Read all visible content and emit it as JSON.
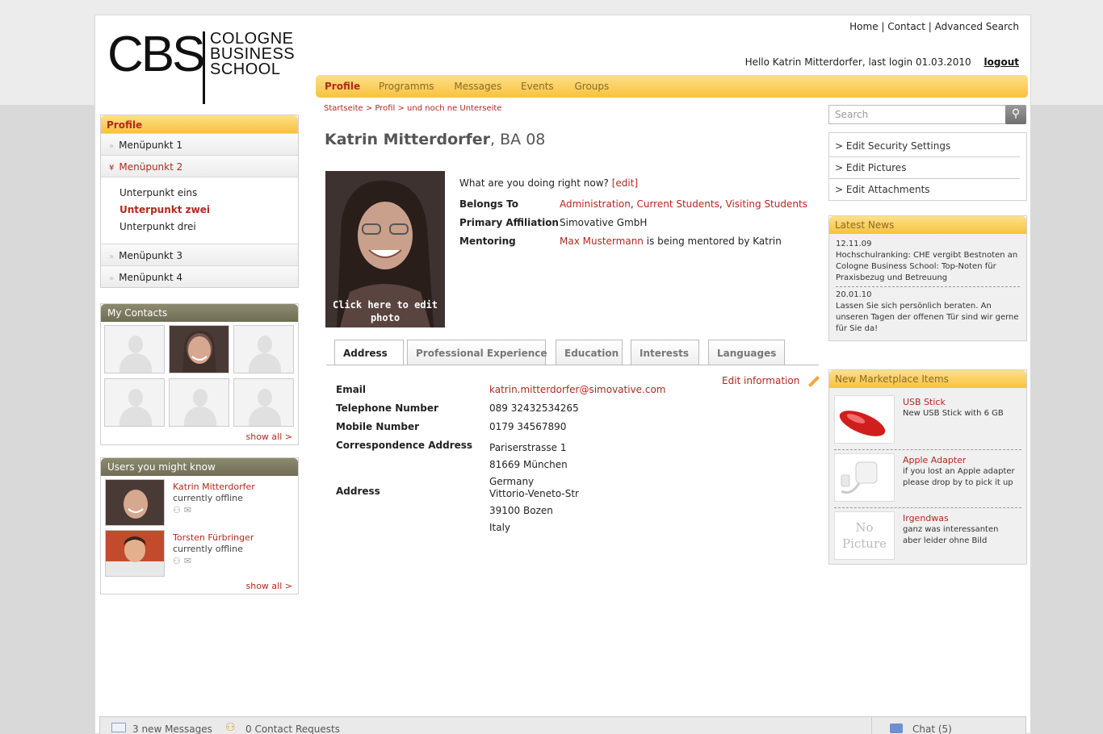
{
  "logo": {
    "abbr": "CBS",
    "line1": "COLOGNE",
    "line2": "BUSINESS",
    "line3": "SCHOOL"
  },
  "toplinks": {
    "home": "Home",
    "contact": "Contact",
    "advanced": "Advanced Search",
    "sep": "|"
  },
  "user": {
    "greeting": "Hello Katrin Mitterdorfer, last login 01.03.2010",
    "logout": "logout"
  },
  "nav": [
    "Profile",
    "Programms",
    "Messages",
    "Events",
    "Groups"
  ],
  "breadcrumb": "Startseite > Profil > und noch ne Unterseite",
  "sidebar": {
    "title": "Profile",
    "items": [
      "Menüpunkt 1",
      "Menüpunkt 2",
      "Menüpunkt 3",
      "Menüpunkt 4"
    ],
    "subitems": [
      "Unterpunkt eins",
      "Unterpunkt zwei",
      "Unterpunkt drei"
    ]
  },
  "contacts": {
    "title": "My Contacts",
    "show_all": "show all >"
  },
  "suggest": {
    "title": "Users you might know",
    "users": [
      {
        "name": "Katrin Mitterdorfer",
        "status": "currently offline"
      },
      {
        "name": "Torsten Fürbringer",
        "status": "currently offline"
      }
    ],
    "show_all": "show all >"
  },
  "profile": {
    "name": "Katrin Mitterdorfer",
    "suffix": ", BA 08",
    "photo_caption_1": "Click here to edit",
    "photo_caption_2": "photo",
    "status_q": "What are you doing right now?",
    "edit": "[edit]",
    "belongs_label": "Belongs To",
    "belongs": [
      "Administration",
      "Current Students",
      "Visiting Students"
    ],
    "comma": ",",
    "primary_label": "Primary Affiliation",
    "primary": "Simovative GmbH",
    "mentoring_label": "Mentoring",
    "mentor": "Max Mustermann",
    "mentor_rest": "is being mentored by Katrin"
  },
  "tabs": [
    "Address",
    "Professional Experience",
    "Education",
    "Interests",
    "Languages"
  ],
  "edit_information": "Edit information",
  "address": {
    "email_label": "Email",
    "email": "katrin.mitterdorfer@simovative.com",
    "tel_label": "Telephone Number",
    "tel": "089 32432534265",
    "mobile_label": "Mobile Number",
    "mobile": "0179 34567890",
    "corr_label": "Correspondence Address",
    "corr": [
      "Pariserstrasse 1",
      "81669 München",
      "Germany"
    ],
    "addr_label": "Address",
    "addr": [
      "Vittorio-Veneto-Str",
      "39100 Bozen",
      "Italy"
    ]
  },
  "search": {
    "placeholder": "Search"
  },
  "account_links": [
    "> Edit Security Settings",
    "> Edit Pictures",
    "> Edit Attachments"
  ],
  "news": {
    "title": "Latest News",
    "items": [
      {
        "date": "12.11.09",
        "text": "Hochschulranking: CHE vergibt Bestnoten an Cologne Business School: Top-Noten für Praxisbezug und Betreuung"
      },
      {
        "date": "20.01.10",
        "text": "Lassen Sie sich persönlich beraten. An unseren Tagen der offenen Tür sind wir gerne für Sie da!"
      }
    ]
  },
  "marketplace": {
    "title": "New Marketplace Items",
    "items": [
      {
        "title": "USB Stick",
        "desc": "New USB Stick with 6 GB"
      },
      {
        "title": "Apple Adapter",
        "desc": "if you lost an Apple adapter please drop by to pick it up"
      },
      {
        "title": "Irgendwas",
        "desc": "ganz was interessanten aber leider ohne Bild"
      }
    ],
    "nopic_1": "No",
    "nopic_2": "Picture"
  },
  "bottom": {
    "messages": "3 new Messages",
    "requests": "0 Contact Requests",
    "chat": "Chat (5)"
  },
  "colors": {
    "accent": "#b0291e",
    "nav_yellow": "#f8c23c",
    "olive": "#7a7860"
  }
}
